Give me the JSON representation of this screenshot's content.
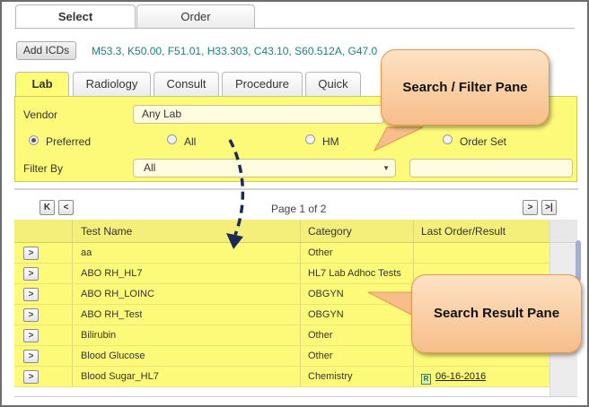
{
  "top_tabs": [
    {
      "label": "Select",
      "active": true
    },
    {
      "label": "Order",
      "active": false
    }
  ],
  "icd": {
    "button_label": "Add ICDs",
    "codes": "M53.3, K50.00, F51.01, H33.303, C43.10, S60.512A, G47.0"
  },
  "sub_tabs": [
    {
      "label": "Lab",
      "active": true
    },
    {
      "label": "Radiology",
      "active": false
    },
    {
      "label": "Consult",
      "active": false
    },
    {
      "label": "Procedure",
      "active": false
    },
    {
      "label": "Quick",
      "active": false
    }
  ],
  "filter": {
    "vendor_label": "Vendor",
    "vendor_value": "Any Lab",
    "radios": [
      {
        "label": "Preferred",
        "checked": true
      },
      {
        "label": "All",
        "checked": false
      },
      {
        "label": "HM",
        "checked": false
      },
      {
        "label": "Order Set",
        "checked": false
      }
    ],
    "filter_by_label": "Filter By",
    "filter_by_value": "All",
    "filter_text_value": ""
  },
  "pager": {
    "first": "K",
    "prev": "<",
    "label": "Page 1 of 2",
    "next": ">",
    "last": ">|"
  },
  "grid": {
    "headers": [
      "Test Name",
      "Category",
      "Last Order/Result"
    ],
    "rows": [
      {
        "test": "aa",
        "category": "Other",
        "last": ""
      },
      {
        "test": "ABO RH_HL7",
        "category": "HL7 Lab Adhoc Tests",
        "last": ""
      },
      {
        "test": "ABO RH_LOINC",
        "category": "OBGYN",
        "last": ""
      },
      {
        "test": "ABO RH_Test",
        "category": "OBGYN",
        "last": ""
      },
      {
        "test": "Bilirubin",
        "category": "Other",
        "last": ""
      },
      {
        "test": "Blood Glucose",
        "category": "Other",
        "last": ""
      },
      {
        "test": "Blood Sugar_HL7",
        "category": "Chemistry",
        "last": "06-16-2016"
      }
    ],
    "row_button": ">",
    "result_icon": "R"
  },
  "callouts": {
    "filter_pane": "Search / Filter Pane",
    "result_pane": "Search Result Pane"
  },
  "colors": {
    "highlight": "#fdfa7a",
    "callout_fill": "#f7be8a",
    "icd_text": "#1c7e8a",
    "arrow": "#1d2b57"
  }
}
